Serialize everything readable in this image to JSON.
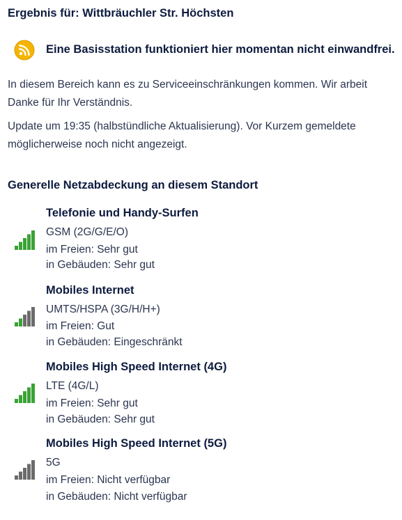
{
  "header": {
    "title": "Ergebnis für: Wittbräuchler Str. Höchsten"
  },
  "alert": {
    "icon": "signal-warning-icon",
    "text": "Eine Basisstation funktioniert hier momentan nicht einwandfrei."
  },
  "info": {
    "line1": "In diesem Bereich kann es zu Serviceeinschränkungen kommen. Wir arbeit",
    "line2": "Danke für Ihr Verständnis.",
    "line3": "Update um 19:35 (halbstündliche Aktualisierung). Vor Kurzem gemeldete",
    "line4": "möglicherweise noch nicht angezeigt."
  },
  "coverage": {
    "title": "Generelle Netzabdeckung an diesem Standort",
    "items": [
      {
        "title": "Telefonie und Handy-Surfen",
        "tech": "GSM (2G/G/E/O)",
        "outdoor": "im Freien: Sehr gut",
        "indoor": "in Gebäuden: Sehr gut",
        "level": 5
      },
      {
        "title": "Mobiles Internet",
        "tech": "UMTS/HSPA (3G/H/H+)",
        "outdoor": "im Freien: Gut",
        "indoor": "in Gebäuden: Eingeschränkt",
        "level": 2
      },
      {
        "title": "Mobiles High Speed Internet (4G)",
        "tech": "LTE (4G/L)",
        "outdoor": "im Freien: Sehr gut",
        "indoor": "in Gebäuden: Sehr gut",
        "level": 5
      },
      {
        "title": "Mobiles High Speed Internet (5G)",
        "tech": "5G",
        "outdoor": "im Freien: Nicht verfügbar",
        "indoor": "in Gebäuden: Nicht verfügbar",
        "level": 0
      }
    ]
  },
  "colors": {
    "bar_on": "#3aa335",
    "bar_off": "#6b6b6b",
    "warning": "#f5b400"
  }
}
